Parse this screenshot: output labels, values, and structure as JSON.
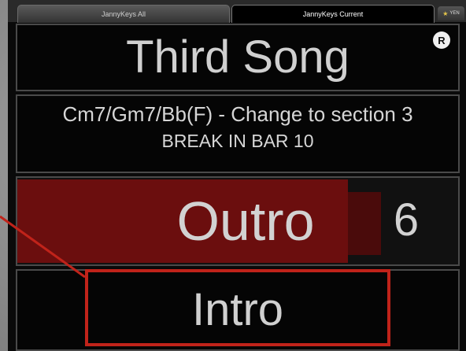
{
  "tabs": [
    {
      "label": "JannyKeys All"
    },
    {
      "label": "JannyKeys Current"
    }
  ],
  "mini_tab": {
    "label": "YEN"
  },
  "song": {
    "title": "Third Song",
    "badge": "R"
  },
  "notes": {
    "line1": "Cm7/Gm7/Bb(F) - Change to section 3",
    "line2": "BREAK IN BAR 10"
  },
  "current_section": {
    "name": "Outro",
    "bar_count": "6",
    "progress": 0.75
  },
  "next_section": {
    "name": "Intro"
  },
  "colors": {
    "section_fill": "#6b0e0e",
    "callout": "#c0231a"
  }
}
